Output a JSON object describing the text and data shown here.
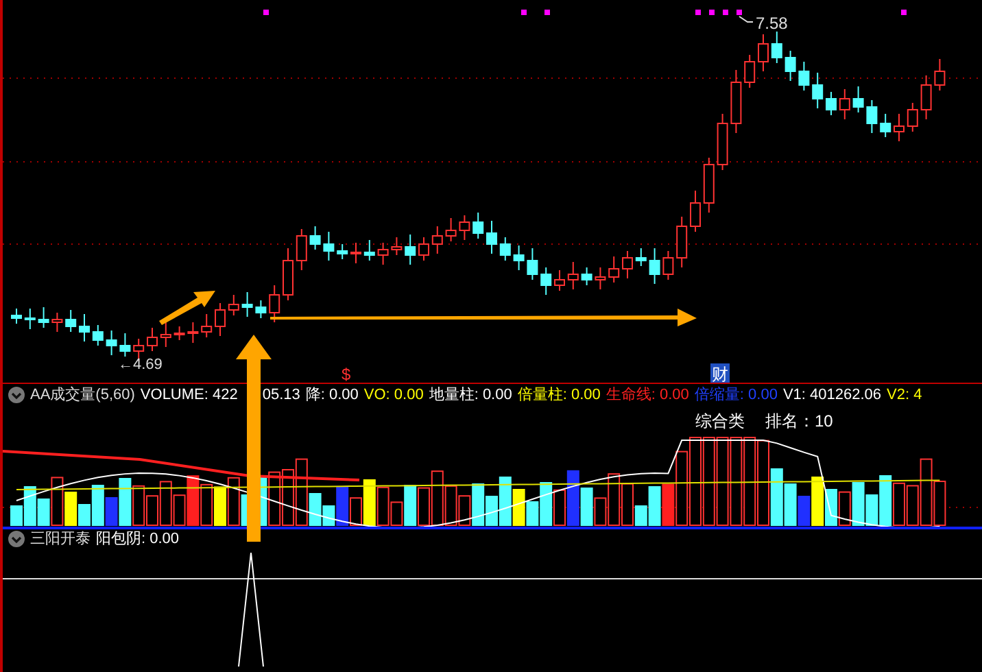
{
  "price_panel": {
    "low_label": "←4.69",
    "high_label": "7.58",
    "event_markers": [
      {
        "kind": "dollar",
        "text": "$"
      },
      {
        "kind": "finance",
        "text": "财"
      }
    ]
  },
  "volume_panel": {
    "title": "AA成交量(5,60)",
    "values": [
      {
        "text": "VOLUME: 422",
        "color": "#ffffff"
      },
      {
        "text": "05.13",
        "color": "#ffffff"
      },
      {
        "text": "降: 0.00",
        "color": "#ffffff"
      },
      {
        "text": "VO: 0.00",
        "color": "#ffff00"
      },
      {
        "text": "地量柱: 0.00",
        "color": "#ffffff"
      },
      {
        "text": "倍量柱: 0.00",
        "color": "#ffff00"
      },
      {
        "text": "生命线: 0.00",
        "color": "#ff2020"
      },
      {
        "text": "倍缩量: 0.00",
        "color": "#2040ff"
      },
      {
        "text": "V1: 401262.06",
        "color": "#ffffff"
      },
      {
        "text": "V2: 4",
        "color": "#ffff00"
      }
    ],
    "labels": [
      "综合类",
      "排名：10"
    ]
  },
  "signal_panel": {
    "title": "三阳开泰",
    "values": [
      {
        "text": "阳包阴: 0.00",
        "color": "#ffffff"
      }
    ]
  }
}
